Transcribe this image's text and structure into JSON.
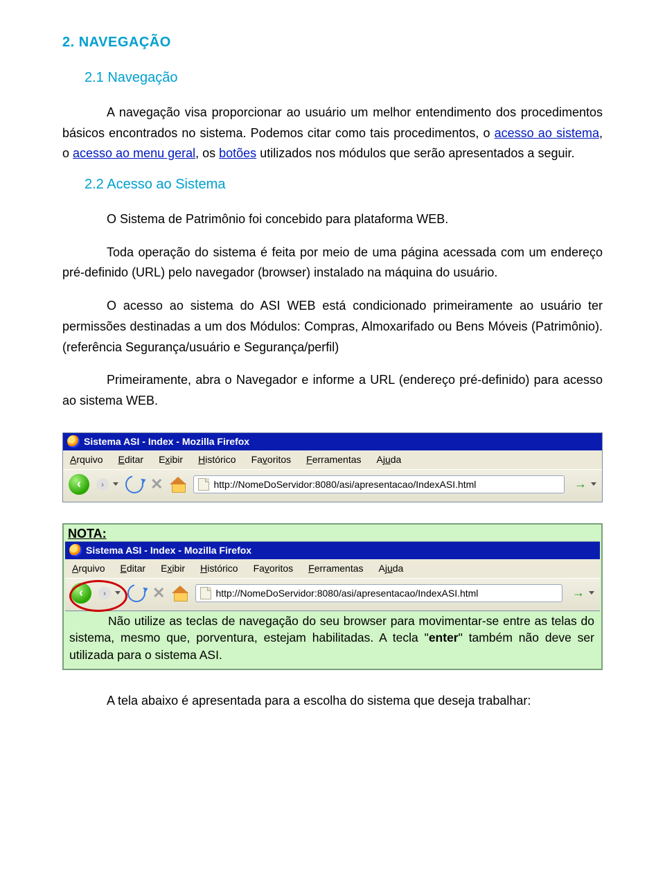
{
  "section_heading": "2. NAVEGAÇÃO",
  "sub21": "2.1 Navegação",
  "p21a_pre": "A navegação visa proporcionar ao usuário um melhor entendimento dos procedimentos básicos encontrados no sistema. Podemos citar como tais procedimentos, o ",
  "link_acesso_sistema": "acesso ao sistema",
  "p21a_mid1": ", o ",
  "link_acesso_menu": "acesso ao menu geral",
  "p21a_mid2": ", os ",
  "link_botoes": "botões",
  "p21a_post": " utilizados nos módulos que serão apresentados a seguir.",
  "sub22": "2.2 Acesso ao Sistema",
  "p22a": "O Sistema de Patrimônio foi concebido para plataforma WEB.",
  "p22b": "Toda operação do sistema é feita por meio de uma página acessada com um endereço pré-definido (URL) pelo navegador (browser) instalado na máquina do usuário.",
  "p22c": "O acesso ao sistema do ASI WEB está condicionado primeiramente ao usuário ter permissões destinadas a um dos Módulos: Compras, Almoxarifado ou Bens Móveis (Patrimônio). (referência Segurança/usuário e Segurança/perfil)",
  "p22d": "Primeiramente, abra o Navegador e informe a URL (endereço pré-definido) para acesso ao sistema WEB.",
  "browser": {
    "title": "Sistema ASI - Index - Mozilla Firefox",
    "menu": {
      "arquivo": "Arquivo",
      "editar": "Editar",
      "exibir": "Exibir",
      "historico": "Histórico",
      "favoritos": "Favoritos",
      "ferramentas": "Ferramentas",
      "ajuda": "Ajuda"
    },
    "url": "http://NomeDoServidor:8080/asi/apresentacao/IndexASI.html"
  },
  "nota_label": "NOTA:",
  "nota_text_pre": "Não utilize as teclas de navegação do seu browser para movimentar-se entre as telas do sistema, mesmo que, porventura, estejam habilitadas. A tecla \"",
  "nota_bold": "enter",
  "nota_text_post": "\" também não deve ser utilizada para o sistema ASI.",
  "p_after_nota": "A tela abaixo é apresentada para a escolha do sistema que deseja trabalhar:"
}
